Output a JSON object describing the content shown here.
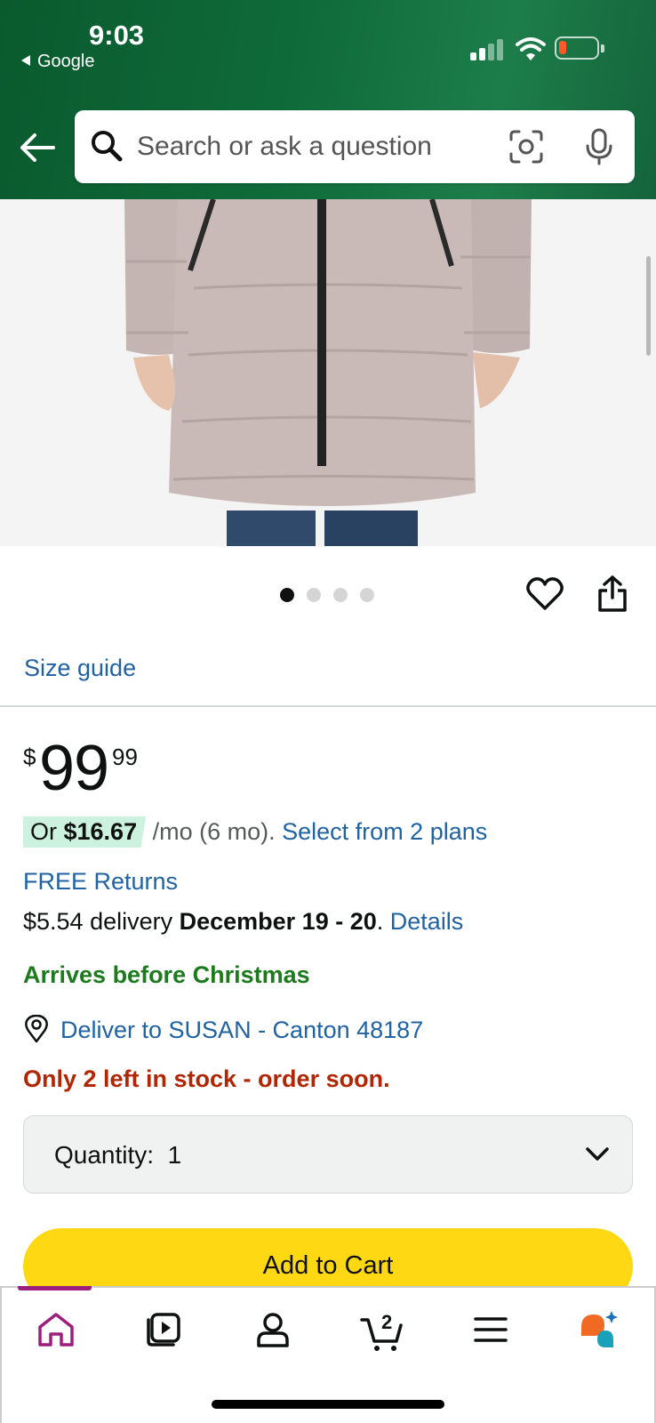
{
  "status_bar": {
    "time": "9:03",
    "back_app": "Google",
    "icons": [
      "cellular-signal-icon",
      "wifi-icon",
      "battery-low-icon"
    ]
  },
  "header": {
    "search_placeholder": "Search or ask a question",
    "icons": [
      "back-arrow-icon",
      "search-icon",
      "camera-lens-icon",
      "microphone-icon"
    ]
  },
  "product": {
    "image_description_icon": "puffer-coat-image",
    "carousel": {
      "count": 4,
      "active_index": 0
    },
    "actions": [
      "heart-icon",
      "share-icon"
    ]
  },
  "size_guide": "Size guide",
  "price": {
    "symbol": "$",
    "whole": "99",
    "fraction": "99"
  },
  "monthly": {
    "prefix": "Or ",
    "amount": "$16.67",
    "term": " /mo (6 mo).",
    "plans_link": "Select from 2 plans"
  },
  "free_returns": "FREE Returns",
  "delivery": {
    "cost": "$5.54 delivery ",
    "dates": "December 19 - 20",
    "period": ".",
    "details_link": "Details"
  },
  "arrives": "Arrives before Christmas",
  "deliver_to": "Deliver to SUSAN - Canton 48187",
  "stock": "Only 2 left in stock - order soon.",
  "quantity": {
    "label": "Quantity:",
    "value": "1"
  },
  "add_to_cart": "Add to Cart",
  "bottom_nav": {
    "items": [
      "home-icon",
      "video-icon",
      "account-icon",
      "cart-icon",
      "menu-icon",
      "rufus-assistant-icon"
    ],
    "cart_count": "2",
    "active": "home-icon"
  },
  "colors": {
    "header_green": "#0f6b3a",
    "link_blue": "#2162a1",
    "in_stock_green": "#1e7a1e",
    "stock_warning_red": "#b12704",
    "add_to_cart_yellow": "#ffd814",
    "nav_active": "#9c1f7d"
  }
}
